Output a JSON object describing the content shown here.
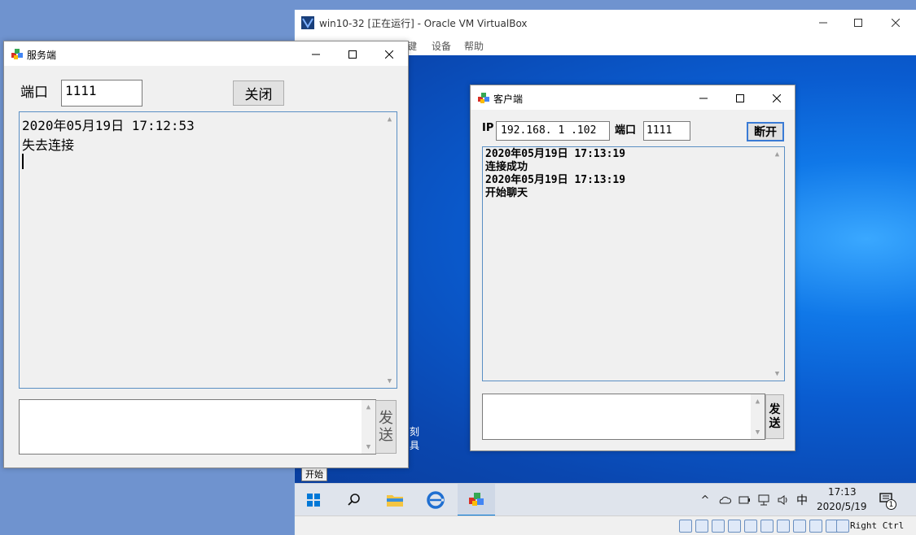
{
  "vbox": {
    "title": "win10-32 [正在运行] - Oracle VM VirtualBox",
    "menu": [
      "键",
      "设备",
      "帮助"
    ],
    "status_host_key": "Right Ctrl"
  },
  "server": {
    "title": "服务端",
    "port_label": "端口",
    "port_value": "1111",
    "close_button": "关闭",
    "log": [
      "2020年05月19日  17:12:53",
      "失去连接"
    ],
    "send_label_1": "发",
    "send_label_2": "送",
    "input_value": ""
  },
  "client": {
    "title": "客户端",
    "ip_label": "IP",
    "ip_value": "192.168. 1  .102",
    "port_label": "端口",
    "port_value": "1111",
    "disconnect_button": "断开",
    "log": [
      "2020年05月19日 17:13:19",
      "连接成功",
      "2020年05月19日 17:13:19",
      "开始聊天"
    ],
    "send_label_1": "发",
    "send_label_2": "送",
    "input_value": ""
  },
  "desktop": {
    "partial_icon_text_1": "刻",
    "partial_icon_text_2": "具",
    "start_tooltip": "开始"
  },
  "taskbar": {
    "ime": "中",
    "time": "17:13",
    "date": "2020/5/19",
    "notification_count": "1"
  },
  "colors": {
    "accent": "#0078d7",
    "desktop_blue": "#0a5cd0",
    "host_bg": "#6f93cf"
  }
}
